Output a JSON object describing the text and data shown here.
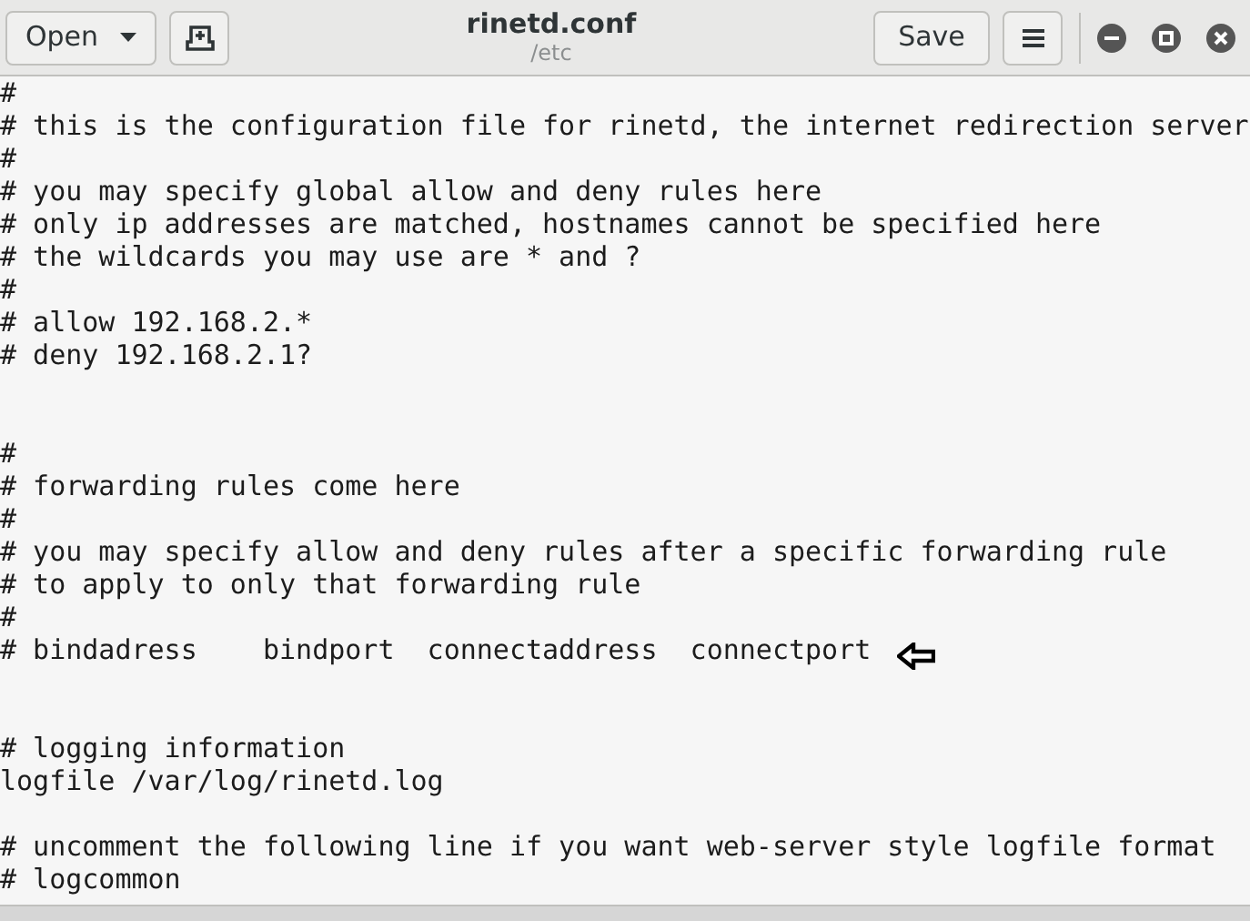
{
  "header": {
    "open_label": "Open",
    "title": "rinetd.conf",
    "subtitle": "/etc",
    "save_label": "Save"
  },
  "lines": [
    {
      "kind": "text",
      "text": "#",
      "pointer": false
    },
    {
      "kind": "text",
      "text": "# this is the configuration file for rinetd, the internet redirection server",
      "pointer": false
    },
    {
      "kind": "text",
      "text": "#",
      "pointer": false
    },
    {
      "kind": "text",
      "text": "# you may specify global allow and deny rules here",
      "pointer": false
    },
    {
      "kind": "text",
      "text": "# only ip addresses are matched, hostnames cannot be specified here",
      "pointer": false
    },
    {
      "kind": "text",
      "text": "# the wildcards you may use are * and ?",
      "pointer": false
    },
    {
      "kind": "text",
      "text": "#",
      "pointer": false
    },
    {
      "kind": "text",
      "text": "# allow 192.168.2.*",
      "pointer": false
    },
    {
      "kind": "text",
      "text": "# deny 192.168.2.1?",
      "pointer": false
    },
    {
      "kind": "blank"
    },
    {
      "kind": "blank"
    },
    {
      "kind": "text",
      "text": "#",
      "pointer": false
    },
    {
      "kind": "text",
      "text": "# forwarding rules come here",
      "pointer": false
    },
    {
      "kind": "text",
      "text": "#",
      "pointer": false
    },
    {
      "kind": "text",
      "text": "# you may specify allow and deny rules after a specific forwarding rule",
      "pointer": false
    },
    {
      "kind": "text",
      "text": "# to apply to only that forwarding rule",
      "pointer": false
    },
    {
      "kind": "text",
      "text": "#",
      "pointer": false
    },
    {
      "kind": "text",
      "text": "# bindadress    bindport  connectaddress  connectport",
      "pointer": true
    },
    {
      "kind": "blank"
    },
    {
      "kind": "blank"
    },
    {
      "kind": "text",
      "text": "# logging information",
      "pointer": false
    },
    {
      "kind": "text",
      "text": "logfile /var/log/rinetd.log",
      "pointer": false
    },
    {
      "kind": "blank"
    },
    {
      "kind": "text",
      "text": "# uncomment the following line if you want web-server style logfile format",
      "pointer": false
    },
    {
      "kind": "text",
      "text": "# logcommon",
      "pointer": false
    }
  ]
}
